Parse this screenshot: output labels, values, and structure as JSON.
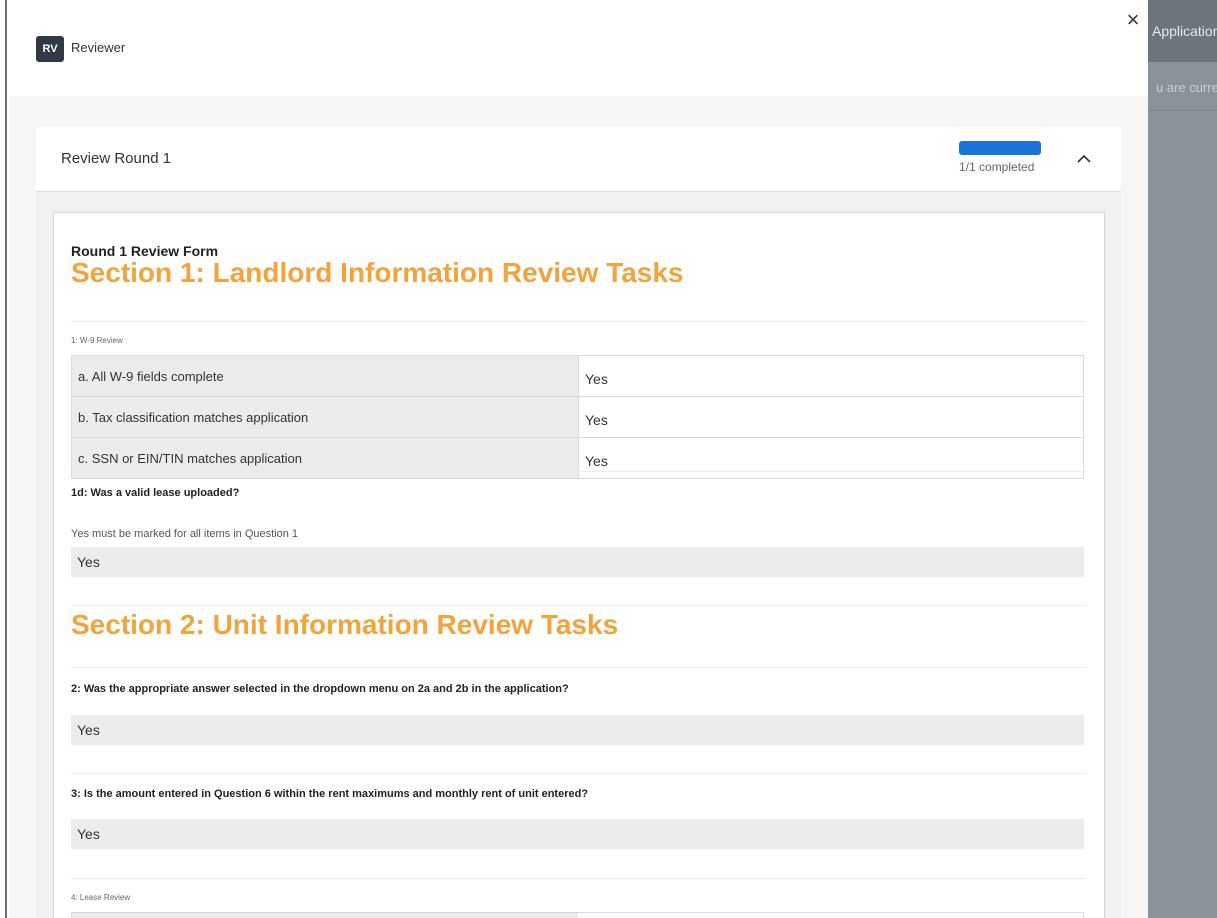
{
  "background_app": {
    "header_text": "Application",
    "sub_text": "u are currently"
  },
  "header": {
    "badge": "RV",
    "reviewer_name": "Reviewer",
    "close_icon": "close-icon"
  },
  "review_round": {
    "title": "Review Round 1",
    "progress_fraction": 1.0,
    "progress_text": "1/1 completed",
    "collapse_icon": "chevron-up-icon"
  },
  "form": {
    "title": "Round 1 Review Form",
    "section1": {
      "title": "Section 1: Landlord Information Review Tasks",
      "w9_label": "1: W-9 Review",
      "w9_rows": [
        {
          "question": "a. All W-9 fields complete",
          "answer": "Yes"
        },
        {
          "question": "b. Tax classification matches application",
          "answer": "Yes"
        },
        {
          "question": "c. SSN or EIN/TIN matches application",
          "answer": "Yes"
        }
      ],
      "q1d": "1d: Was a valid lease uploaded?",
      "q1d_note": "Yes must be marked for all items in Question 1",
      "q1d_answer": "Yes"
    },
    "section2": {
      "title": "Section 2: Unit Information Review Tasks",
      "q2": "2: Was the appropriate answer selected in the dropdown menu on 2a and 2b in the application?",
      "q2_answer": "Yes",
      "q3": "3: Is the amount entered in Question 6 within the rent maximums and monthly rent of unit entered?",
      "q3_answer": "Yes",
      "lease_label": "4: Lease Review"
    }
  },
  "colors": {
    "accent_orange": "#f4a23a",
    "progress_blue": "#1a73d9",
    "badge_dark": "#2f3a44"
  }
}
